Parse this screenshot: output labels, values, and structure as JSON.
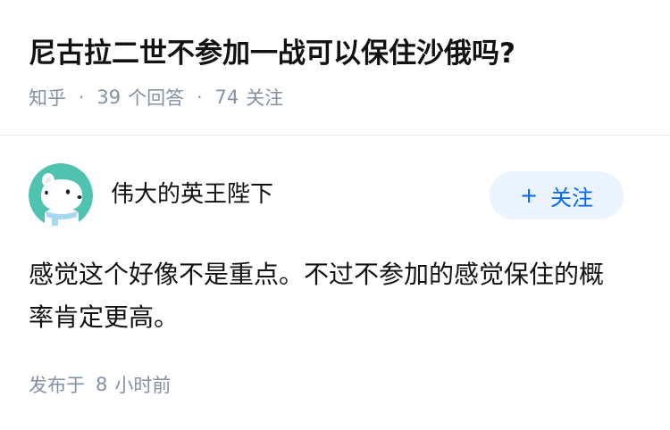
{
  "question": {
    "title": "尼古拉二世不参加一战可以保住沙俄吗?",
    "source": "知乎",
    "answer_count": "39",
    "answer_label": "个回答",
    "follower_count": "74",
    "follower_label": "关注"
  },
  "author": {
    "name": "伟大的英王陛下",
    "avatar_icon": "polar-bear-avatar-icon",
    "follow_label": "关注",
    "follow_icon": "plus-icon"
  },
  "answer": {
    "content": "感觉这个好像不是重点。不过不参加的感觉保住的概率肯定更高。",
    "time_prefix": "发布于",
    "time_value": "8",
    "time_suffix": "小时前"
  },
  "colors": {
    "title": "#121212",
    "meta": "#8590a6",
    "follow_bg": "#ebf4ff",
    "follow_text": "#0066ff",
    "avatar_bg": "#4fc2b0"
  }
}
